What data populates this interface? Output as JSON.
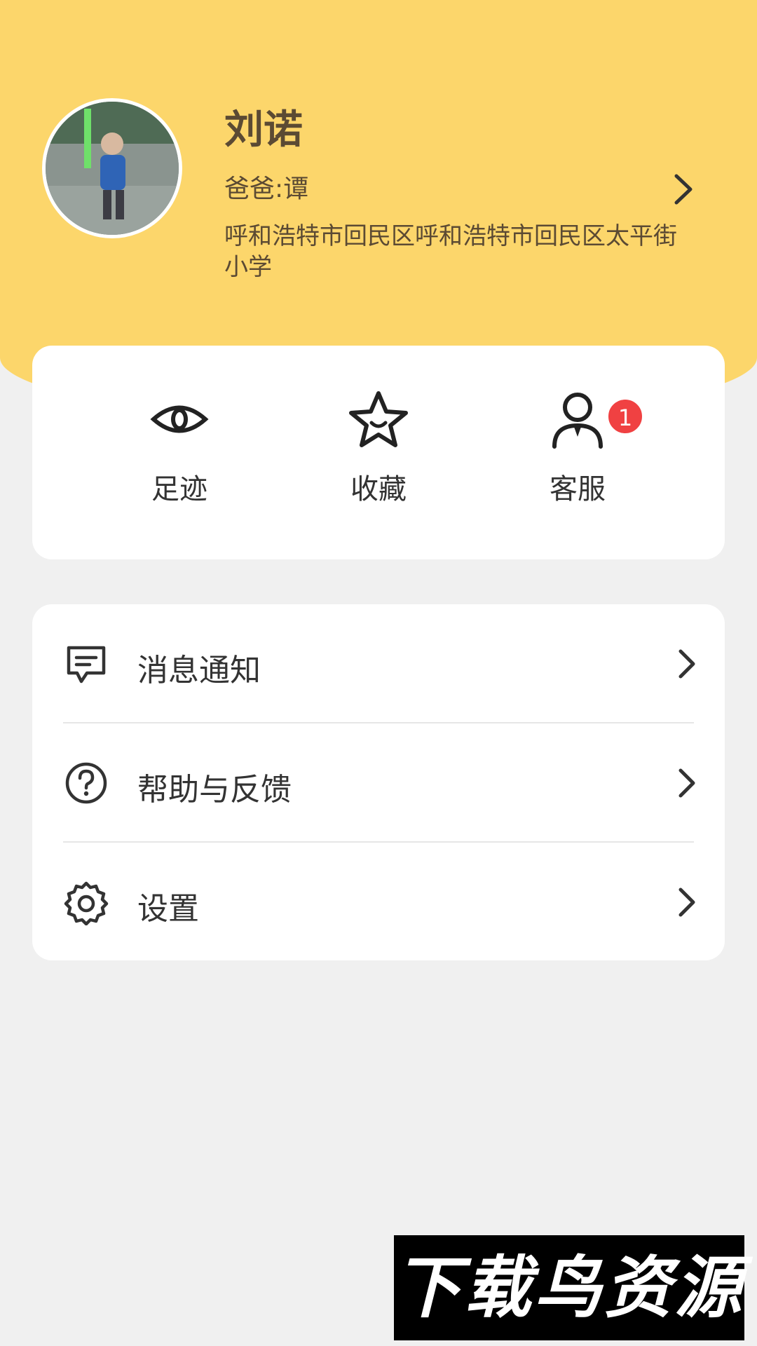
{
  "profile": {
    "name": "刘诺",
    "parent": "爸爸:谭",
    "school": "呼和浩特市回民区呼和浩特市回民区太平街小学"
  },
  "quick_actions": [
    {
      "label": "足迹",
      "icon": "eye-icon"
    },
    {
      "label": "收藏",
      "icon": "star-icon"
    },
    {
      "label": "客服",
      "icon": "customer-service-icon",
      "badge": "1"
    }
  ],
  "menu": [
    {
      "label": "消息通知",
      "icon": "message-icon"
    },
    {
      "label": "帮助与反馈",
      "icon": "help-icon"
    },
    {
      "label": "设置",
      "icon": "gear-icon"
    }
  ],
  "watermark": "下载鸟资源",
  "colors": {
    "header": "#fcd66b",
    "badge": "#f04142",
    "text_brown": "#5b4a33"
  }
}
